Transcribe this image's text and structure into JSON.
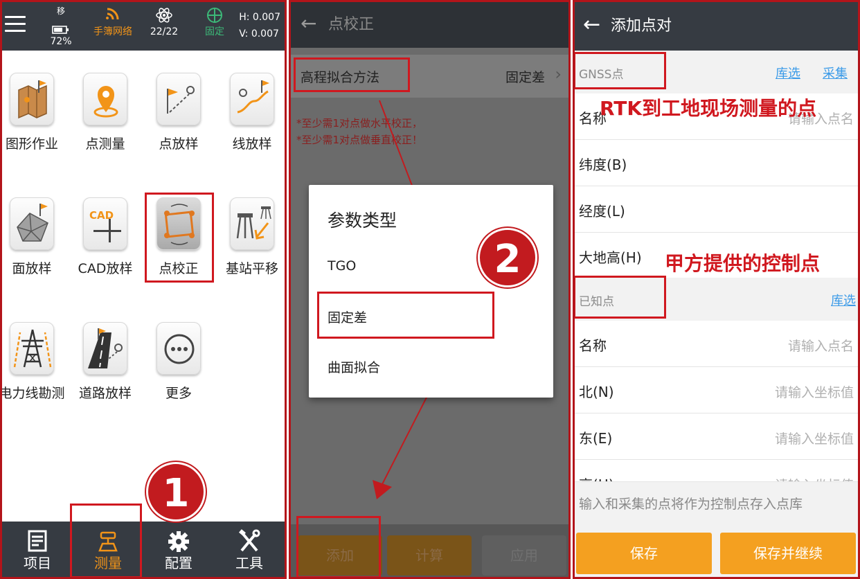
{
  "panel1": {
    "status": {
      "move_label": "移",
      "battery": "72%",
      "network": "手簿网络",
      "satellites": "22/22",
      "fix": "固定",
      "h_value": "H: 0.007",
      "v_value": "V: 0.007"
    },
    "apps": [
      {
        "label": "图形作业",
        "icon": "map-icon"
      },
      {
        "label": "点测量",
        "icon": "point-survey-icon"
      },
      {
        "label": "点放样",
        "icon": "point-stakeout-icon"
      },
      {
        "label": "线放样",
        "icon": "line-stakeout-icon"
      },
      {
        "label": "面放样",
        "icon": "surface-stakeout-icon"
      },
      {
        "label": "CAD放样",
        "icon": "cad-icon"
      },
      {
        "label": "点校正",
        "icon": "calibration-icon"
      },
      {
        "label": "基站平移",
        "icon": "base-shift-icon"
      },
      {
        "label": "电力线勘测",
        "icon": "power-line-icon"
      },
      {
        "label": "道路放样",
        "icon": "road-stakeout-icon"
      },
      {
        "label": "更多",
        "icon": "more-icon"
      }
    ],
    "cad_text": "CAD",
    "nav": [
      {
        "label": "项目",
        "icon": "project-icon"
      },
      {
        "label": "测量",
        "icon": "survey-icon"
      },
      {
        "label": "配置",
        "icon": "settings-gear-icon"
      },
      {
        "label": "工具",
        "icon": "tools-icon"
      }
    ],
    "step_badge": "1"
  },
  "panel2": {
    "title": "点校正",
    "method_label": "高程拟合方法",
    "method_value": "固定差",
    "warnings": [
      "*至少需1对点做水平校正，",
      "*至少需1对点做垂直校正！"
    ],
    "dialog": {
      "title": "参数类型",
      "options": [
        "TGO",
        "固定差",
        "曲面拟合"
      ]
    },
    "buttons": [
      "添加",
      "计算",
      "应用"
    ],
    "step_badge": "2"
  },
  "panel3": {
    "title": "添加点对",
    "gnss_section": {
      "label": "GNSS点",
      "link1": "库选",
      "link2": "采集"
    },
    "gnss_fields": [
      {
        "label": "名称",
        "placeholder": "请输入点名"
      },
      {
        "label": "纬度(B)",
        "placeholder": ""
      },
      {
        "label": "经度(L)",
        "placeholder": ""
      },
      {
        "label": "大地高(H)",
        "placeholder": ""
      }
    ],
    "known_section": {
      "label": "已知点",
      "link1": "库选"
    },
    "known_fields": [
      {
        "label": "名称",
        "placeholder": "请输入点名"
      },
      {
        "label": "北(N)",
        "placeholder": "请输入坐标值"
      },
      {
        "label": "东(E)",
        "placeholder": "请输入坐标值"
      },
      {
        "label": "高(H)",
        "placeholder": "请输入坐标值"
      }
    ],
    "note": "输入和采集的点将作为控制点存入点库",
    "save": "保存",
    "save_continue": "保存并继续",
    "callout_gnss": "RTK到工地现场测量的点",
    "callout_known": "甲方提供的控制点"
  },
  "colors": {
    "accent_orange": "#f4a020",
    "highlight_red": "#d0181f",
    "link_blue": "#3a9ae8",
    "dark_bar": "#363b42"
  }
}
